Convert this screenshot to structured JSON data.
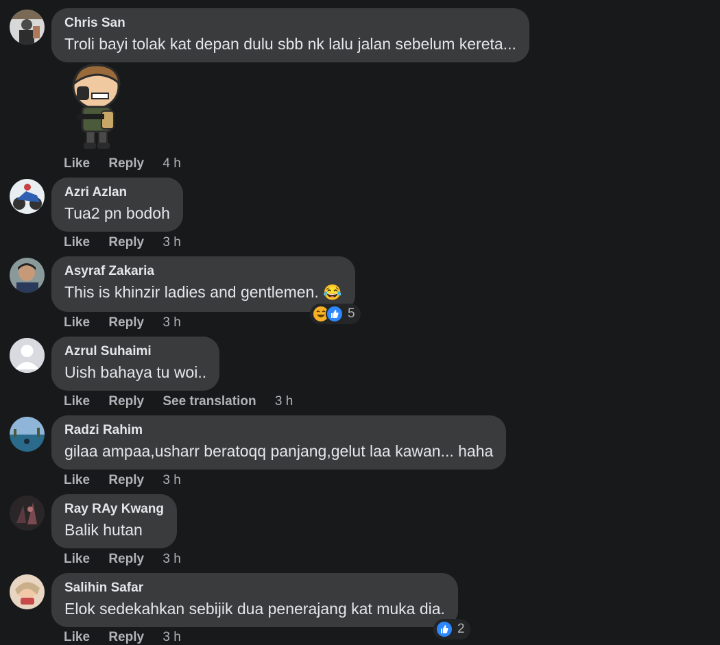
{
  "actions": {
    "like": "Like",
    "reply": "Reply",
    "see_translation": "See translation"
  },
  "comments": [
    {
      "author": "Chris San",
      "text": "Troli bayi tolak kat depan dulu sbb nk lalu jalan sebelum kereta...",
      "time": "4 h",
      "sticker": "soldier-sticker"
    },
    {
      "author": "Azri Azlan",
      "text": "Tua2 pn bodoh",
      "time": "3 h"
    },
    {
      "author": "Asyraf Zakaria",
      "text": "This is khinzir ladies and gentlemen.",
      "emoji": "😂",
      "time": "3 h",
      "reaction_count": "5"
    },
    {
      "author": "Azrul Suhaimi",
      "text": "Uish bahaya tu woi..",
      "time": "3 h"
    },
    {
      "author": "Radzi Rahim",
      "text": "gilaa ampaa,usharr beratoqq panjang,gelut laa kawan... haha",
      "time": "3 h"
    },
    {
      "author": "Ray RAy Kwang",
      "text": "Balik hutan",
      "time": "3 h"
    },
    {
      "author": "Salihin Safar",
      "text": "Elok sedekahkan sebijik dua penerajang kat muka dia.",
      "time": "3 h",
      "reaction_count": "2"
    }
  ],
  "colors": {
    "background": "#18191a",
    "bubble": "#3a3b3c",
    "meta": "#b0b3b8",
    "like_blue": "#2d88ff",
    "haha_yellow": "#f7b125"
  }
}
